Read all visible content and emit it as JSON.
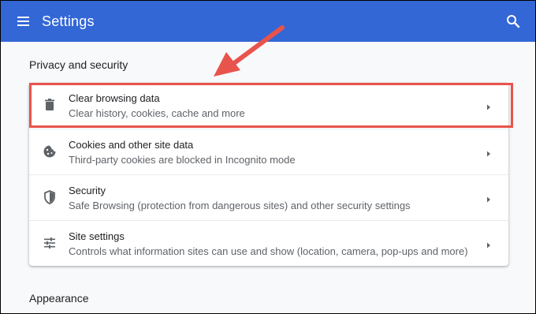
{
  "header": {
    "title": "Settings",
    "menu_icon": "hamburger-menu-icon",
    "search_icon": "search-icon",
    "background_color": "#3367d6"
  },
  "sections": {
    "privacy_title": "Privacy and security",
    "appearance_title": "Appearance"
  },
  "privacy_items": [
    {
      "icon": "trash-icon",
      "title": "Clear browsing data",
      "subtitle": "Clear history, cookies, cache and more"
    },
    {
      "icon": "cookie-icon",
      "title": "Cookies and other site data",
      "subtitle": "Third-party cookies are blocked in Incognito mode"
    },
    {
      "icon": "shield-icon",
      "title": "Security",
      "subtitle": "Safe Browsing (protection from dangerous sites) and other security settings"
    },
    {
      "icon": "sliders-icon",
      "title": "Site settings",
      "subtitle": "Controls what information sites can use and show (location, camera, pop-ups and more)"
    }
  ],
  "annotation": {
    "highlight_color": "#e8534c",
    "arrow_color": "#e8534c"
  }
}
